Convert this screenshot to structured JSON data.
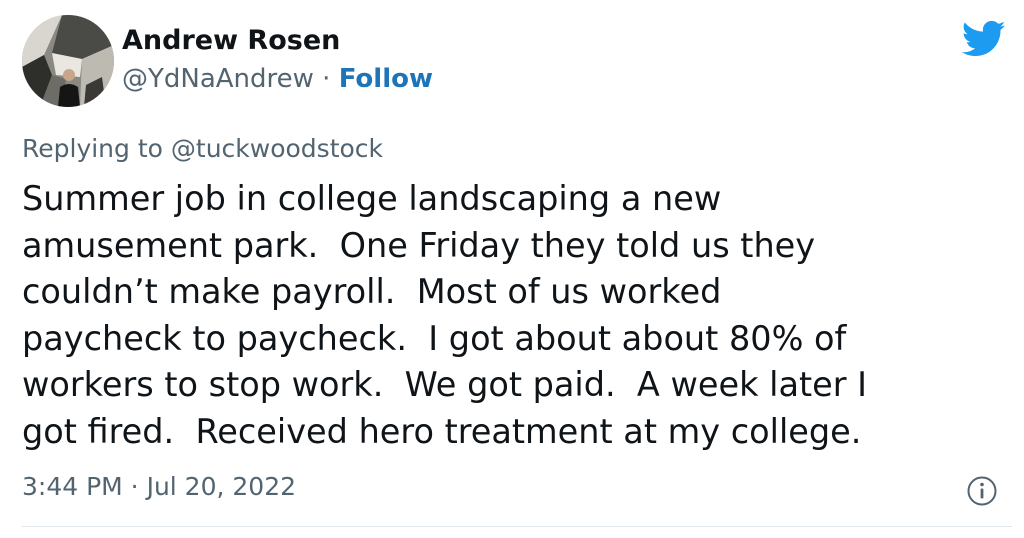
{
  "author": {
    "display_name": "Andrew Rosen",
    "handle": "@YdNaAndrew",
    "separator": " · ",
    "follow_label": "Follow",
    "avatar_icon": "profile-photo"
  },
  "reply_context": {
    "prefix": "Replying to ",
    "mention": "@tuckwoodstock"
  },
  "tweet": {
    "lines": [
      "Summer job in college landscaping a new",
      "amusement park.  One Friday they told us they",
      "couldn’t make payroll.  Most of us worked",
      "paycheck to paycheck.  I got about about 80% of",
      "workers to stop work.  We got paid.  A week later I",
      "got fired.  Received hero treatment at my college."
    ]
  },
  "meta": {
    "timestamp": "3:44 PM · Jul 20, 2022"
  },
  "icons": {
    "brand": "twitter-bird-icon",
    "info": "info-icon"
  },
  "colors": {
    "brand": "#1d9bf0",
    "link": "#1d74b8",
    "secondary_text": "#536471",
    "primary_text": "#0f1419"
  }
}
